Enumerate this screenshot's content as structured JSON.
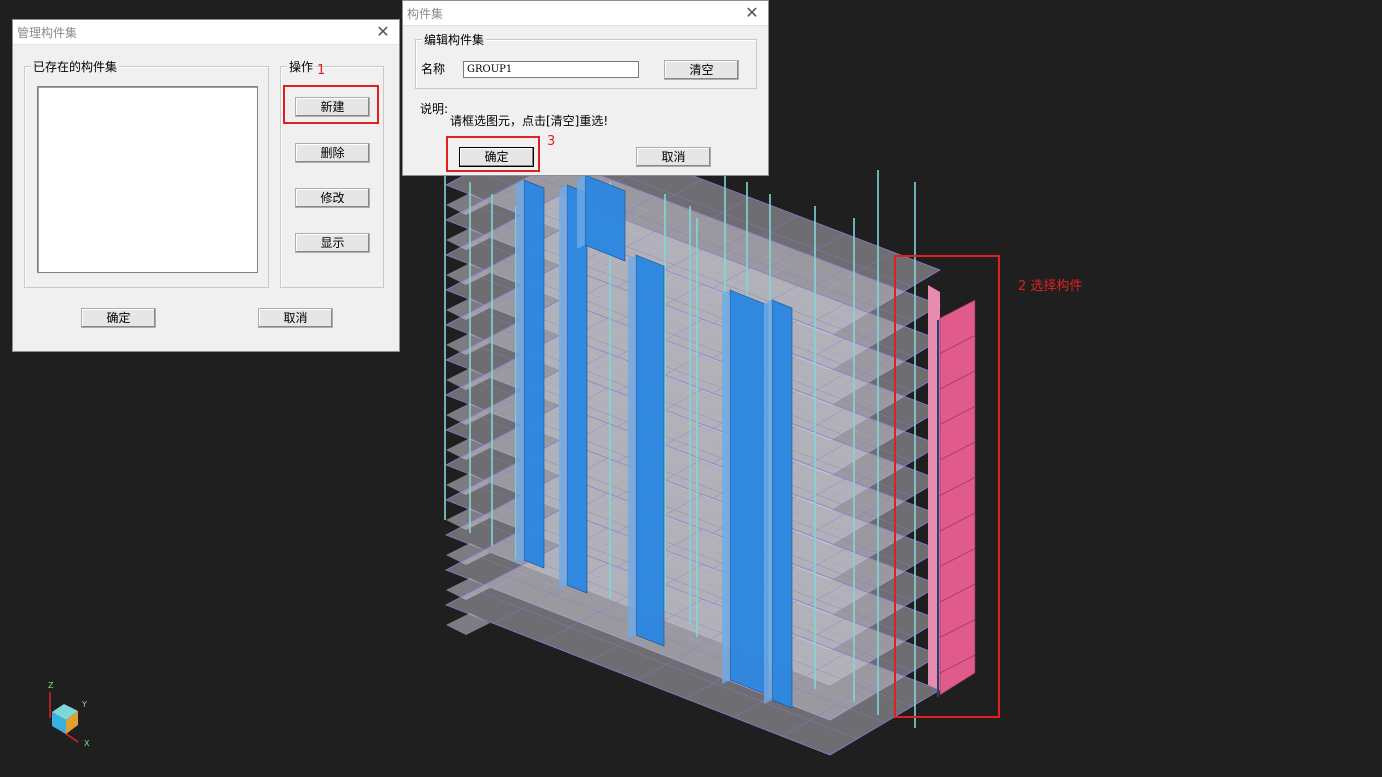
{
  "manage_dialog": {
    "title": "管理构件集",
    "existing_group_label": "已存在的构件集",
    "operations_label": "操作",
    "new_label": "新建",
    "delete_label": "删除",
    "modify_label": "修改",
    "show_label": "显示",
    "ok_label": "确定",
    "cancel_label": "取消"
  },
  "edit_dialog": {
    "title": "构件集",
    "group_label": "编辑构件集",
    "name_label": "名称",
    "name_value": "GROUP1",
    "clear_label": "清空",
    "note_label": "说明:",
    "note_text": "请框选图元，点击[清空]重选!",
    "ok_label": "确定",
    "cancel_label": "取消"
  },
  "annotations": {
    "step1": "1",
    "step2": "2 选择构件",
    "step3": "3",
    "color": "#e02020"
  },
  "axis_triad": {
    "z": "Z",
    "y": "Y",
    "x": "X"
  },
  "colors": {
    "background": "#1f1f1f",
    "wall_blue": "#2a86e0",
    "column_cyan": "#7fd8d8",
    "selected_wall": "#e05a8a",
    "slab": "#cfcfd6",
    "beam_purple": "#8a7bd4"
  }
}
